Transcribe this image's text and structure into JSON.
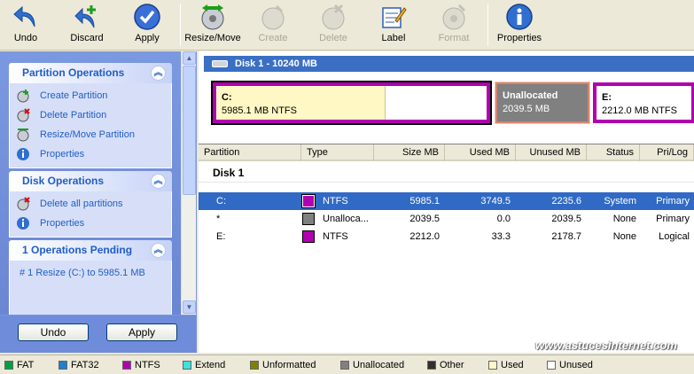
{
  "toolbar": {
    "undo": "Undo",
    "discard": "Discard",
    "apply": "Apply",
    "resize_move": "Resize/Move",
    "create": "Create",
    "delete": "Delete",
    "label": "Label",
    "format": "Format",
    "properties": "Properties"
  },
  "tasks": {
    "partition_ops": {
      "title": "Partition Operations",
      "items": [
        "Create Partition",
        "Delete Partition",
        "Resize/Move Partition",
        "Properties"
      ]
    },
    "disk_ops": {
      "title": "Disk Operations",
      "items": [
        "Delete all partitions",
        "Properties"
      ]
    },
    "pending": {
      "title": "1 Operations Pending",
      "items": [
        "#  1  Resize (C:) to 5985.1 MB"
      ]
    }
  },
  "panel_buttons": {
    "undo": "Undo",
    "apply": "Apply"
  },
  "disk_map": {
    "header": "Disk 1 - 10240 MB",
    "blocks": [
      {
        "name": "C:",
        "detail": "5985.1 MB  NTFS",
        "used_fraction": 0.626
      },
      {
        "name": "Unallocated",
        "detail": "2039.5 MB"
      },
      {
        "name": "E:",
        "detail": "2212.0 MB  NTFS"
      }
    ]
  },
  "table": {
    "headers": [
      "Partition",
      "Type",
      "Size MB",
      "Used MB",
      "Unused MB",
      "Status",
      "Pri/Log"
    ],
    "disk_label": "Disk 1",
    "rows": [
      {
        "partition": "C:",
        "type": "NTFS",
        "size": "5985.1",
        "used": "3749.5",
        "unused": "2235.6",
        "status": "System",
        "prilog": "Primary",
        "color": "#b000b0",
        "selected": true
      },
      {
        "partition": "*",
        "type": "Unalloca...",
        "size": "2039.5",
        "used": "0.0",
        "unused": "2039.5",
        "status": "None",
        "prilog": "Primary",
        "color": "#808080",
        "selected": false
      },
      {
        "partition": "E:",
        "type": "NTFS",
        "size": "2212.0",
        "used": "33.3",
        "unused": "2178.7",
        "status": "None",
        "prilog": "Logical",
        "color": "#b000b0",
        "selected": false
      }
    ]
  },
  "watermark": "www.astucesinternet.com",
  "legend": [
    {
      "label": "FAT",
      "color": "#00a040"
    },
    {
      "label": "FAT32",
      "color": "#2080d0"
    },
    {
      "label": "NTFS",
      "color": "#b000b0"
    },
    {
      "label": "Extend",
      "color": "#40e0e0"
    },
    {
      "label": "Unformatted",
      "color": "#808000"
    },
    {
      "label": "Unallocated",
      "color": "#808080"
    },
    {
      "label": "Other",
      "color": "#303030"
    },
    {
      "label": "Used",
      "color": "#fff8c4"
    },
    {
      "label": "Unused",
      "color": "#ffffff"
    }
  ]
}
